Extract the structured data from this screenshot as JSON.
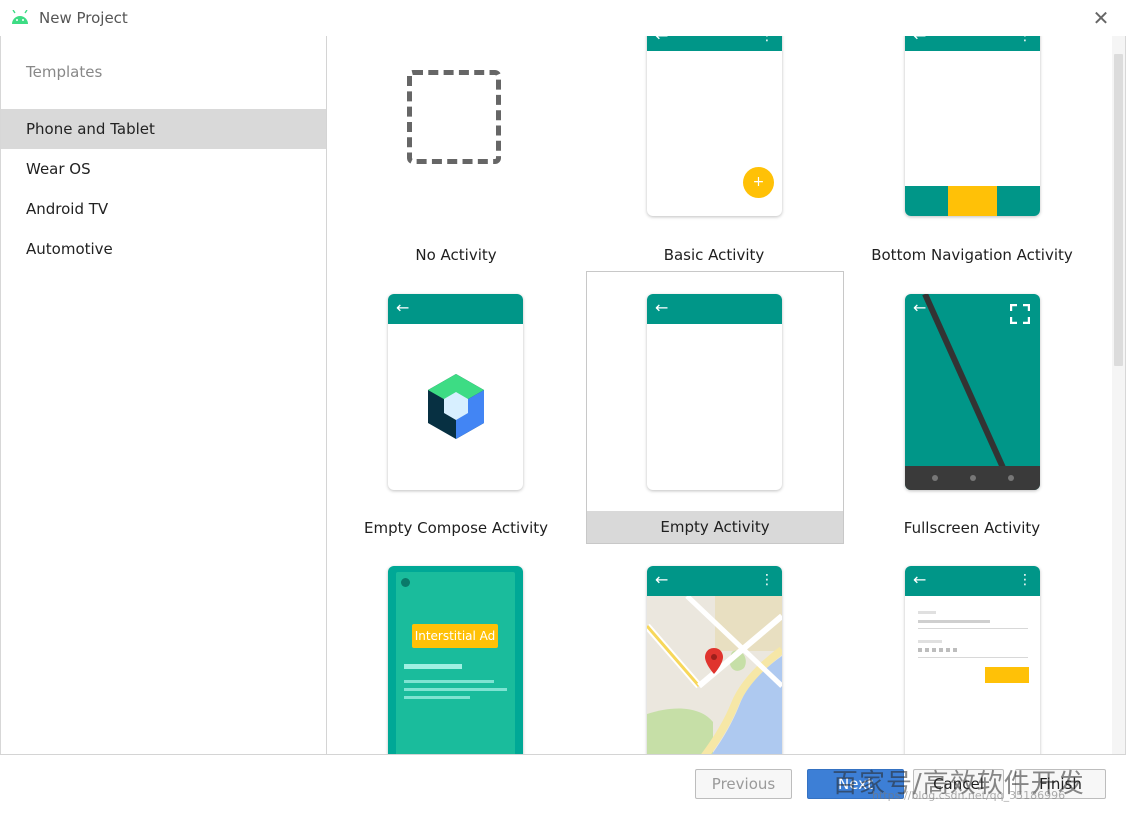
{
  "window": {
    "title": "New Project",
    "close_glyph": "✕",
    "icon": "android-icon"
  },
  "sidebar": {
    "heading": "Templates",
    "items": [
      {
        "label": "Phone and Tablet",
        "selected": true
      },
      {
        "label": "Wear OS",
        "selected": false
      },
      {
        "label": "Android TV",
        "selected": false
      },
      {
        "label": "Automotive",
        "selected": false
      }
    ]
  },
  "templates": [
    {
      "label": "No Activity"
    },
    {
      "label": "Basic Activity",
      "fab_glyph": "+"
    },
    {
      "label": "Bottom Navigation Activity"
    },
    {
      "label": "Empty Compose Activity"
    },
    {
      "label": "Empty Activity",
      "selected": true
    },
    {
      "label": "Fullscreen Activity"
    },
    {
      "label": "",
      "ad_text": "Interstitial Ad"
    },
    {
      "label": ""
    },
    {
      "label": ""
    }
  ],
  "buttons": {
    "previous": "Previous",
    "next": "Next",
    "cancel": "Cancel",
    "finish": "Finish"
  },
  "watermark": {
    "text": "百家号/高效软件开发",
    "url": "https://blog.csdn.net/qq_35186996"
  },
  "colors": {
    "teal": "#009688",
    "amber": "#FFC107",
    "accent_blue": "#3D7FD6"
  }
}
